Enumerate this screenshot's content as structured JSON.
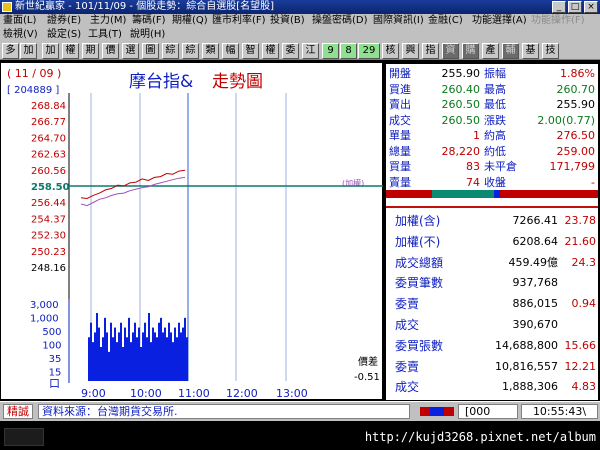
{
  "window": {
    "title": "新世紀贏家 - 101/11/09 - 個股走勢：綜合自選股[名望股]",
    "buttons": [
      "_",
      "□",
      "×"
    ]
  },
  "menu": {
    "row1": [
      "畫面(L)",
      "證券(E)",
      "主力(M)",
      "籌碼(F)",
      "期權(Q)",
      "匯市利率(F)",
      "投資(B)",
      "操盤密碼(D)",
      "國際資訊(I)",
      "金融(C)",
      "功能選擇(A)",
      "功能操作(F)"
    ],
    "row2": [
      "檢視(V)",
      "設定(S)",
      "工具(T)",
      "說明(H)"
    ]
  },
  "toolbar": [
    "多",
    "加",
    "權",
    "期",
    "價",
    "選",
    "圖",
    "綜",
    "綜",
    "類",
    "幅",
    "智",
    "權",
    "委",
    "江",
    "9",
    "8",
    "29",
    "核",
    "興",
    "指",
    "資",
    "購",
    "產",
    "輔",
    "基",
    "技"
  ],
  "chart": {
    "period": "( 11 / 09 )",
    "id": "[ 204889 ]",
    "title_red": "走勢圖",
    "title_blue": "摩台指&",
    "add_label": "(加權)",
    "spread_label": "價差",
    "spread_value": "-0.51",
    "vol_unit": "口",
    "time_labels": [
      "9:00",
      "10:00",
      "11:00",
      "12:00",
      "13:00"
    ],
    "price_ticks": [
      "268.84",
      "266.77",
      "264.70",
      "262.63",
      "260.56",
      "258.50",
      "256.44",
      "254.37",
      "252.30",
      "250.23",
      "248.16"
    ],
    "volume_ticks": [
      "3,000",
      "1,000",
      "500",
      "100",
      "35",
      "15"
    ],
    "colors": {
      "up": "#c00000",
      "ref": "#0a7a6a",
      "price_line": "#c00000",
      "index_line": "#a050c0",
      "volume": "#0a20e0"
    }
  },
  "chart_data": {
    "type": "line",
    "ylim": [
      248.16,
      268.84
    ],
    "reference": 258.5,
    "series": [
      {
        "name": "price",
        "values": [
          257.0,
          256.9,
          257.3,
          257.6,
          258.0,
          258.2,
          258.6,
          258.5,
          258.9,
          259.0,
          259.4,
          259.2,
          259.6,
          259.7,
          260.1,
          260.0,
          260.4,
          260.5
        ]
      },
      {
        "name": "index",
        "values": [
          256.2,
          256.0,
          256.4,
          256.8,
          257.0,
          257.3,
          257.5,
          257.6,
          257.9,
          258.1,
          258.3,
          258.4,
          258.7,
          258.9,
          259.1,
          259.3,
          259.5,
          259.6
        ]
      }
    ],
    "volume": [
      9,
      12,
      8,
      10,
      14,
      11,
      7,
      9,
      13,
      10,
      6,
      12,
      9,
      11,
      8,
      10,
      12,
      7,
      11,
      9,
      13,
      8,
      10,
      12,
      9,
      11,
      7,
      10,
      12,
      9,
      14,
      8,
      11,
      10,
      9,
      12,
      13,
      10,
      11,
      9,
      12,
      10,
      8,
      11,
      9,
      12,
      10,
      11,
      13,
      9
    ]
  },
  "quote": {
    "rows": [
      {
        "l1": "開盤",
        "v1": "255.90",
        "l2": "振幅",
        "v2": "1.86%",
        "c1": "#000000",
        "c2": "#c00000"
      },
      {
        "l1": "買進",
        "v1": "260.40",
        "l2": "最高",
        "v2": "260.70",
        "c1": "#0a7a1a",
        "c2": "#0a7a1a"
      },
      {
        "l1": "賣出",
        "v1": "260.50",
        "l2": "最低",
        "v2": "255.90",
        "c1": "#0a7a1a",
        "c2": "#000000"
      },
      {
        "l1": "成交",
        "v1": "260.50",
        "l2": "漲跌",
        "v2": "2.00(0.77)",
        "c1": "#0a7a1a",
        "c2": "#0a7a1a"
      },
      {
        "l1": "單量",
        "v1": "1",
        "l2": "約高",
        "v2": "276.50",
        "c1": "#c00000",
        "c2": "#c00000"
      },
      {
        "l1": "總量",
        "v1": "28,220",
        "l2": "約低",
        "v2": "259.00",
        "c1": "#c00000",
        "c2": "#c00000"
      },
      {
        "l1": "買量",
        "v1": "83",
        "l2": "未平倉",
        "v2": "171,799",
        "c1": "#c00000",
        "c2": "#c00000"
      },
      {
        "l1": "賣量",
        "v1": "74",
        "l2": "收盤",
        "v2": "-",
        "c1": "#c00000",
        "c2": "#c00000"
      }
    ]
  },
  "index_rows": [
    {
      "label": "加權(含)",
      "value": "7266.41",
      "chg": "23.78"
    },
    {
      "label": "加權(不)",
      "value": "6208.64",
      "chg": "21.60"
    },
    {
      "label": "成交總額",
      "value": "459.49億",
      "chg": "24.3"
    },
    {
      "label": "委買筆數",
      "value": "937,768",
      "chg": ""
    },
    {
      "label": "委賣",
      "value": "886,015",
      "chg": "0.94"
    },
    {
      "label": "成交",
      "value": "390,670",
      "chg": ""
    },
    {
      "label": "委買張數",
      "value": "14,688,800",
      "chg": "15.66"
    },
    {
      "label": "委賣",
      "value": "10,816,557",
      "chg": "12.21"
    },
    {
      "label": "成交",
      "value": "1,888,306",
      "chg": "4.83"
    }
  ],
  "status": {
    "tag": "精誠",
    "source": "資料來源：台灣期貨交易所.",
    "code": "[000",
    "time": "10:55:43\\"
  },
  "taskbar": {
    "watermark": "http://kujd3268.pixnet.net/album"
  }
}
